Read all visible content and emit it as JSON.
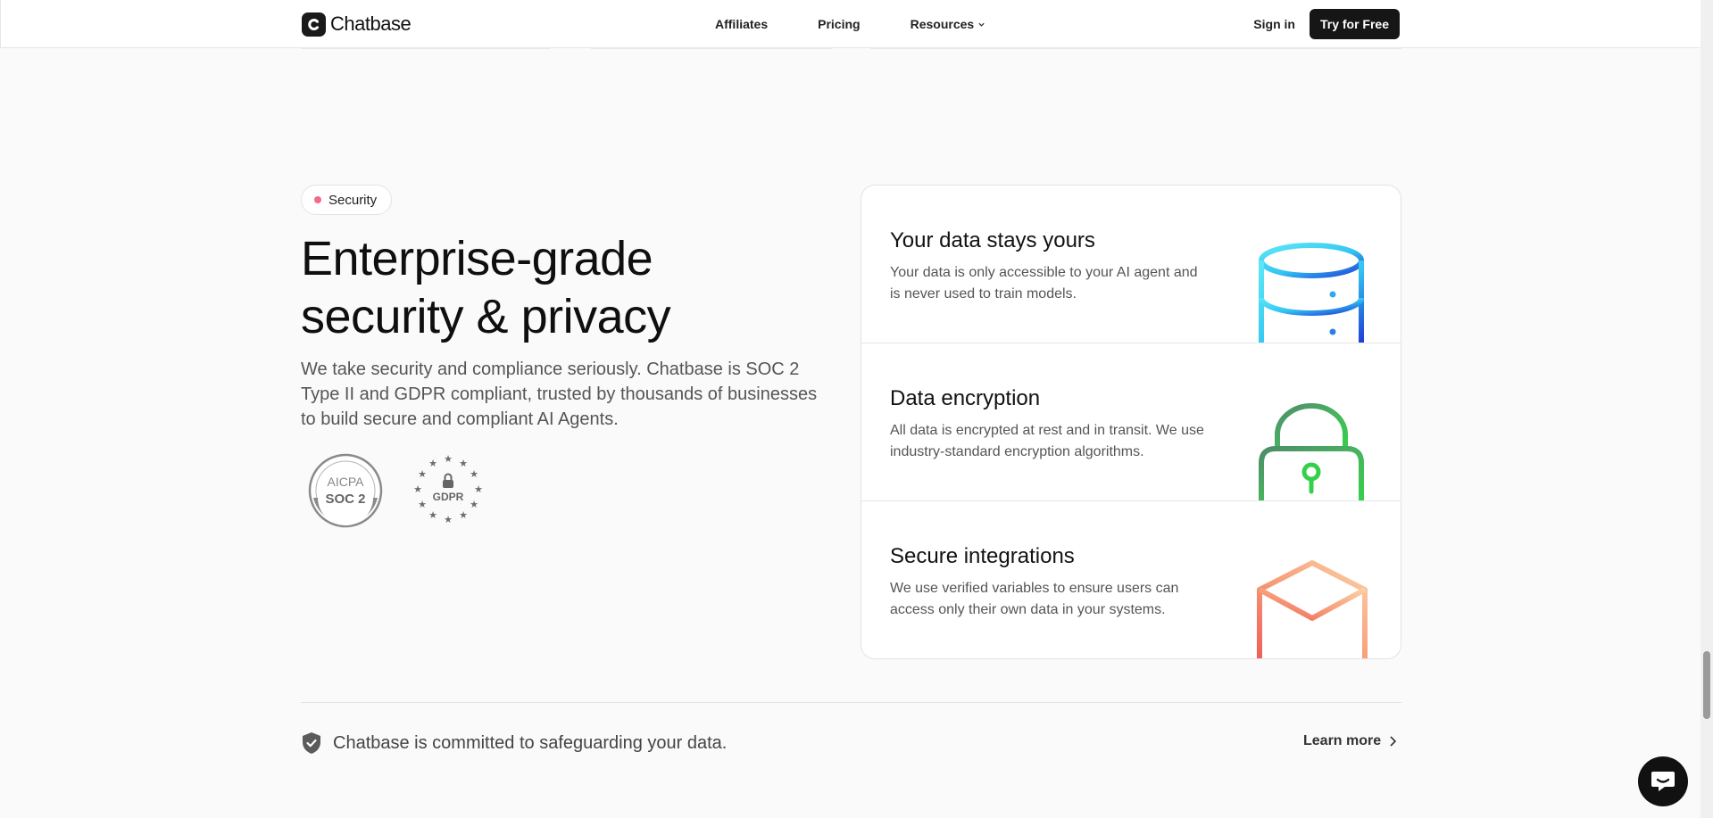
{
  "header": {
    "brand": "Chatbase",
    "nav": [
      {
        "label": "Affiliates"
      },
      {
        "label": "Pricing"
      },
      {
        "label": "Resources"
      }
    ],
    "signin_label": "Sign in",
    "cta_label": "Try for Free"
  },
  "security": {
    "badge_label": "Security",
    "heading_line1": "Enterprise-grade",
    "heading_line2": "security & privacy",
    "description": "We take security and compliance seriously. Chatbase is SOC 2 Type II and GDPR compliant, trusted by thousands of businesses to build secure and compliant AI Agents.",
    "certs": {
      "soc_top": "AICPA",
      "soc_bottom": "SOC 2",
      "gdpr": "GDPR"
    }
  },
  "cards": [
    {
      "title": "Your data stays yours",
      "text": "Your data is only accessible to your AI agent and is never used to train models.",
      "icon": "database-icon"
    },
    {
      "title": "Data encryption",
      "text": "All data is encrypted at rest and in transit. We use industry-standard encryption algorithms.",
      "icon": "lock-icon"
    },
    {
      "title": "Secure integrations",
      "text": "We use verified variables to ensure users can access only their own data in your systems.",
      "icon": "cube-icon"
    }
  ],
  "footer_strip": {
    "commit_text": "Chatbase is committed to safeguarding your data.",
    "learn_more_label": "Learn more"
  },
  "colors": {
    "badge_dot": "#f2698a",
    "cta_bg": "#161616",
    "page_bg": "#fafafa"
  }
}
